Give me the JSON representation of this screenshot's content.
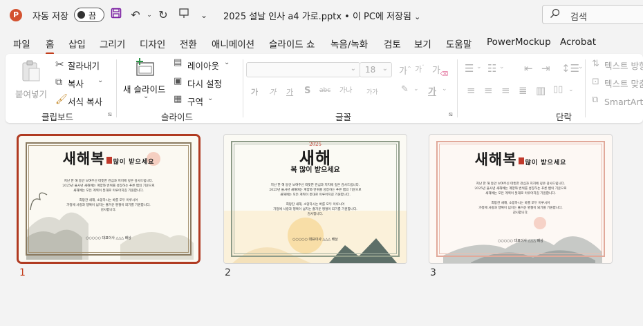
{
  "titlebar": {
    "app_icon_letter": "P",
    "autosave_label": "자동 저장",
    "autosave_toggle": "끔",
    "document_title": "2025 설날 인사 a4 가로.pptx • 이 PC에 저장됨",
    "search_placeholder": "검색",
    "icons": [
      "save-icon",
      "undo-icon",
      "redo-icon",
      "present-icon",
      "qat-more-icon",
      "search-icon"
    ]
  },
  "tabs": [
    "파일",
    "홈",
    "삽입",
    "그리기",
    "디자인",
    "전환",
    "애니메이션",
    "슬라이드 쇼",
    "녹음/녹화",
    "검토",
    "보기",
    "도움말",
    "PowerMockup",
    "Acrobat"
  ],
  "active_tab": "홈",
  "ribbon": {
    "clipboard": {
      "paste": "붙여넣기",
      "cut": "잘라내기",
      "copy": "복사",
      "format_painter": "서식 복사",
      "group_label": "클립보드"
    },
    "slides": {
      "new_slide": "새 슬라이드",
      "layout": "레이아웃",
      "reset": "다시 설정",
      "section": "구역",
      "group_label": "슬라이드"
    },
    "font": {
      "font_size": "18",
      "grow": "가",
      "shrink": "가",
      "clear": "가",
      "bold": "가",
      "italic": "가",
      "underline": "가",
      "strike": "S",
      "spacing": "가나",
      "case": "가가",
      "highlight": "가",
      "font_color": "가",
      "group_label": "글꼴"
    },
    "paragraph": {
      "group_label": "단락",
      "text_direction": "텍스트 방향",
      "align_text": "텍스트 맞춤",
      "smartart": "SmartArt로"
    }
  },
  "slides": [
    {
      "number": "1",
      "selected": true,
      "title_main": "새해복",
      "title_small": "많이 받으세요",
      "body_lines": [
        "지난 한 해 동안 보여주신 따뜻한 관심과 지지에 깊은 감사드립니다.",
        "2025년 을사년 새해에는 계양와 번위를 성장하는 푸른 뱀의 기운으로",
        "새해에는 모든 계획이 뜻대로 이루어지길 기원합니다.",
        "",
        "희망찬 새해, 소망하시는 바를 모두 이루시어",
        "가정에 사랑과 행복이 넘치는 즐거운 명절이 되기를 기원합니다.",
        "감사합니다."
      ],
      "signature": "○○○○○ 대표이사 △△△ 배상"
    },
    {
      "number": "2",
      "selected": false,
      "title_top": "2025",
      "title_main": "새해",
      "title_small": "복 많이 받으세요",
      "body_lines": [
        "지난 한 해 동안 보여주신 따뜻한 관심과 지지에 깊은 감사드립니다.",
        "2025년 을사년 새해에는 계양와 번위를 성장하는 푸른 뱀의 기운으로",
        "새해에는 모든 계획이 뜻대로 이루어지길 기원합니다.",
        "",
        "희망찬 새해, 소망하시는 바를 모두 이루시어",
        "가정에 사랑과 행복이 넘치는 즐거운 명절이 되기를 기원합니다.",
        "감사합니다."
      ],
      "signature": "○○○○○ 대표이사 △△△ 배상"
    },
    {
      "number": "3",
      "selected": false,
      "title_main": "새해복",
      "title_small": "많이 받으세요",
      "body_lines": [
        "지난 한 해 동안 보여주신 따뜻한 관심과 지지에 깊은 감사드립니다.",
        "2025년 을사년 새해에는 계양와 번위를 성장하는 푸른 뱀의 기운으로",
        "새해에는 모든 계획이 뜻대로 이루어지길 기원합니다.",
        "",
        "희망찬 새해, 소망하시는 바를 모두 이루시어",
        "가정에 사랑과 행복이 넘치는 즐거운 명절이 되기를 기원합니다.",
        "감사합니다."
      ],
      "signature": "○○○○○ 대표이사 △△△ 배상"
    }
  ],
  "colors": {
    "accent": "#c43e1c",
    "selection_border": "#b03a21",
    "ribbon_bg": "#ffffff",
    "window_bg": "#f3f3f3"
  }
}
